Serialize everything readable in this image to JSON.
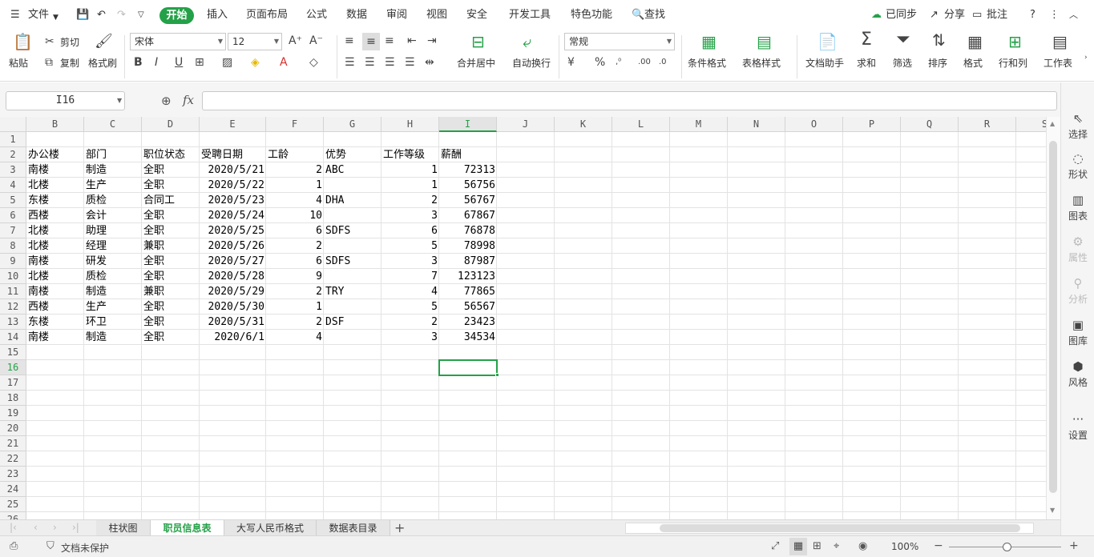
{
  "menu": {
    "file": "文件",
    "tabs": [
      "开始",
      "插入",
      "页面布局",
      "公式",
      "数据",
      "审阅",
      "视图",
      "安全",
      "开发工具",
      "特色功能"
    ],
    "find": "查找",
    "sync": "已同步",
    "share": "分享",
    "comment": "批注"
  },
  "ribbon": {
    "paste": "粘贴",
    "cut": "剪切",
    "copy": "复制",
    "format_painter": "格式刷",
    "font_name": "宋体",
    "font_size": "12",
    "merge_center": "合并居中",
    "wrap": "自动换行",
    "number_format": "常规",
    "cond_format": "条件格式",
    "table_style": "表格样式",
    "doc_helper": "文档助手",
    "sum": "求和",
    "filter": "筛选",
    "sort": "排序",
    "format": "格式",
    "rowcol": "行和列",
    "worksheet": "工作表"
  },
  "formula_bar": {
    "name_box": "I16",
    "fx": "fx",
    "content": ""
  },
  "columns": [
    "B",
    "C",
    "D",
    "E",
    "F",
    "G",
    "H",
    "I",
    "J",
    "K",
    "L",
    "M",
    "N",
    "O",
    "P",
    "Q",
    "R",
    "S"
  ],
  "rows": [
    "1",
    "2",
    "3",
    "4",
    "5",
    "6",
    "7",
    "8",
    "9",
    "10",
    "11",
    "12",
    "13",
    "14",
    "15",
    "16",
    "17",
    "18",
    "19",
    "20",
    "21",
    "22",
    "23",
    "24",
    "25",
    "26"
  ],
  "table": {
    "headers": [
      "办公楼",
      "部门",
      "职位状态",
      "受聘日期",
      "工龄",
      "优势",
      "工作等级",
      "薪酬"
    ],
    "rows": [
      [
        "南楼",
        "制造",
        "全职",
        "2020/5/21",
        "2",
        "ABC",
        "1",
        "72313"
      ],
      [
        "北楼",
        "生产",
        "全职",
        "2020/5/22",
        "1",
        "",
        "1",
        "56756"
      ],
      [
        "东楼",
        "质检",
        "合同工",
        "2020/5/23",
        "4",
        "DHA",
        "2",
        "56767"
      ],
      [
        "西楼",
        "会计",
        "全职",
        "2020/5/24",
        "10",
        "",
        "3",
        "67867"
      ],
      [
        "北楼",
        "助理",
        "全职",
        "2020/5/25",
        "6",
        "SDFS",
        "6",
        "76878"
      ],
      [
        "北楼",
        "经理",
        "兼职",
        "2020/5/26",
        "2",
        "",
        "5",
        "78998"
      ],
      [
        "南楼",
        "研发",
        "全职",
        "2020/5/27",
        "6",
        "SDFS",
        "3",
        "87987"
      ],
      [
        "北楼",
        "质检",
        "全职",
        "2020/5/28",
        "9",
        "",
        "7",
        "123123"
      ],
      [
        "南楼",
        "制造",
        "兼职",
        "2020/5/29",
        "2",
        "TRY",
        "4",
        "77865"
      ],
      [
        "西楼",
        "生产",
        "全职",
        "2020/5/30",
        "1",
        "",
        "5",
        "56567"
      ],
      [
        "东楼",
        "环卫",
        "全职",
        "2020/5/31",
        "2",
        "DSF",
        "2",
        "23423"
      ],
      [
        "南楼",
        "制造",
        "全职",
        "2020/6/1",
        "4",
        "",
        "3",
        "34534"
      ]
    ]
  },
  "sidebar": [
    "选择",
    "形状",
    "图表",
    "属性",
    "分析",
    "图库",
    "风格",
    "设置"
  ],
  "sheet_tabs": [
    "柱状图",
    "职员信息表",
    "大写人民币格式",
    "数据表目录"
  ],
  "active_sheet": "职员信息表",
  "status": {
    "protect": "文档未保护",
    "zoom": "100%"
  },
  "colors": {
    "accent": "#24a148"
  }
}
